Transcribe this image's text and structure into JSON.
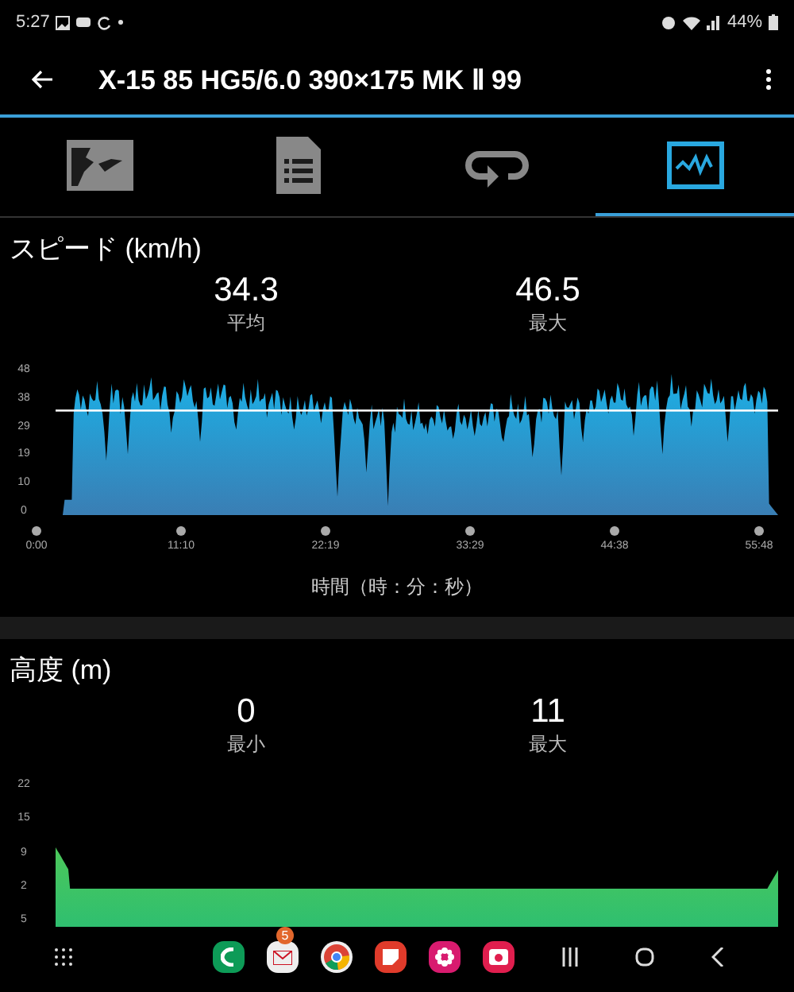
{
  "status_bar": {
    "time": "5:27",
    "battery": "44%"
  },
  "toolbar": {
    "title": "X-15 85 HG5/6.0 390×175 MK Ⅱ 99"
  },
  "tabs": [
    {
      "kind": "map",
      "selected": false
    },
    {
      "kind": "details",
      "selected": false
    },
    {
      "kind": "laps",
      "selected": false
    },
    {
      "kind": "graph",
      "selected": true
    }
  ],
  "sections": [
    {
      "kind": "speed",
      "title": "スピード (km/h)",
      "stats": [
        {
          "value": "34.3",
          "label": "平均"
        },
        {
          "value": "46.5",
          "label": "最大"
        }
      ],
      "y_ticks": [
        "48",
        "38",
        "29",
        "19",
        "10",
        "0"
      ],
      "x_ticks": [
        "0:00",
        "11:10",
        "22:19",
        "33:29",
        "44:38",
        "55:48"
      ],
      "x_label": "時間（時：分：秒）"
    },
    {
      "kind": "elevation",
      "title": "高度 (m)",
      "stats": [
        {
          "value": "0",
          "label": "最小"
        },
        {
          "value": "11",
          "label": "最大"
        }
      ],
      "y_ticks": [
        "22",
        "15",
        "9",
        "2",
        "5"
      ]
    }
  ],
  "dock": {
    "mail_badge": "5"
  }
}
